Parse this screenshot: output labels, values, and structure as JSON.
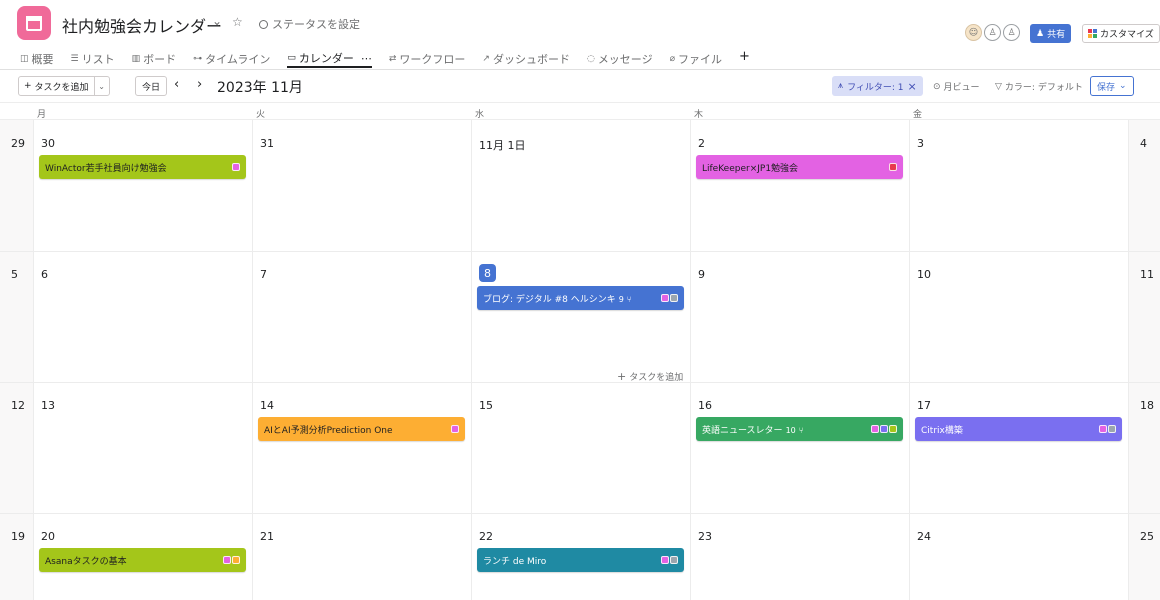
{
  "header": {
    "title": "社内勉強会カレンダー",
    "status_label": "ステータスを設定",
    "share_label": "共有",
    "customize_label": "カスタマイズ",
    "app_color": "#f06a99"
  },
  "tabs": [
    {
      "label": "概要",
      "icon": "overview-icon",
      "glyph": "◫"
    },
    {
      "label": "リスト",
      "icon": "list-icon",
      "glyph": "☰"
    },
    {
      "label": "ボード",
      "icon": "board-icon",
      "glyph": "▥"
    },
    {
      "label": "タイムライン",
      "icon": "timeline-icon",
      "glyph": "⊶"
    },
    {
      "label": "カレンダー",
      "icon": "calendar-icon",
      "glyph": "▭",
      "active": true
    },
    {
      "label": "ワークフロー",
      "icon": "workflow-icon",
      "glyph": "⇄"
    },
    {
      "label": "ダッシュボード",
      "icon": "dashboard-icon",
      "glyph": "↗"
    },
    {
      "label": "メッセージ",
      "icon": "message-icon",
      "glyph": "◌"
    },
    {
      "label": "ファイル",
      "icon": "file-icon",
      "glyph": "⌀"
    }
  ],
  "tab_more": "⋯",
  "toolbar": {
    "add_task_label": "タスクを追加",
    "today_label": "今日",
    "month_title": "2023年 11月",
    "filter_label": "フィルター: 1",
    "month_view_label": "月ビュー",
    "color_label": "カラー: デフォルト",
    "save_label": "保存"
  },
  "weekdays": [
    "月",
    "火",
    "水",
    "木",
    "金"
  ],
  "weeks": [
    {
      "days": [
        "29",
        "30",
        "31",
        "11月 1日",
        "2",
        "3",
        "4"
      ]
    },
    {
      "days": [
        "5",
        "6",
        "7",
        "8",
        "9",
        "10",
        "11"
      ],
      "today_index": 3
    },
    {
      "days": [
        "12",
        "13",
        "14",
        "15",
        "16",
        "17",
        "18"
      ]
    },
    {
      "days": [
        "19",
        "20",
        "21",
        "22",
        "23",
        "24",
        "25"
      ]
    }
  ],
  "inline_add_label": "タスクを追加",
  "tasks": [
    {
      "name": "WinActor若手社員向け勉強会",
      "bg": "#a4c61a",
      "fg": "#1e1f21",
      "tags": [
        "#e362e3"
      ]
    },
    {
      "name": "LifeKeeper×JP1勉強会",
      "bg": "#e362e3",
      "fg": "#1e1f21",
      "tags": [
        "#e8384f"
      ]
    },
    {
      "name": "ブログ: デジタル #8 ヘルシンキ",
      "subtasks": "9",
      "bg": "#4573d2",
      "fg": "#ffffff",
      "tags": [
        "#e362e3",
        "#9ca6af"
      ]
    },
    {
      "name": "AIとAI予測分析Prediction One",
      "bg": "#fdae33",
      "fg": "#1e1f21",
      "tags": [
        "#e362e3"
      ]
    },
    {
      "name": "英語ニュースレター",
      "subtasks": "10",
      "bg": "#37a862",
      "fg": "#ffffff",
      "tags": [
        "#e362e3",
        "#7a6ff0",
        "#a4c61a"
      ]
    },
    {
      "name": "Citrix構築",
      "bg": "#7a6ff0",
      "fg": "#ffffff",
      "tags": [
        "#e362e3",
        "#9ca6af"
      ]
    },
    {
      "name": "Asanaタスクの基本",
      "bg": "#a4c61a",
      "fg": "#1e1f21",
      "tags": [
        "#e362e3",
        "#fdae33"
      ]
    },
    {
      "name": "ランチ de Miro",
      "bg": "#1f8aa3",
      "fg": "#ffffff",
      "tags": [
        "#e362e3",
        "#9ca6af"
      ]
    }
  ]
}
